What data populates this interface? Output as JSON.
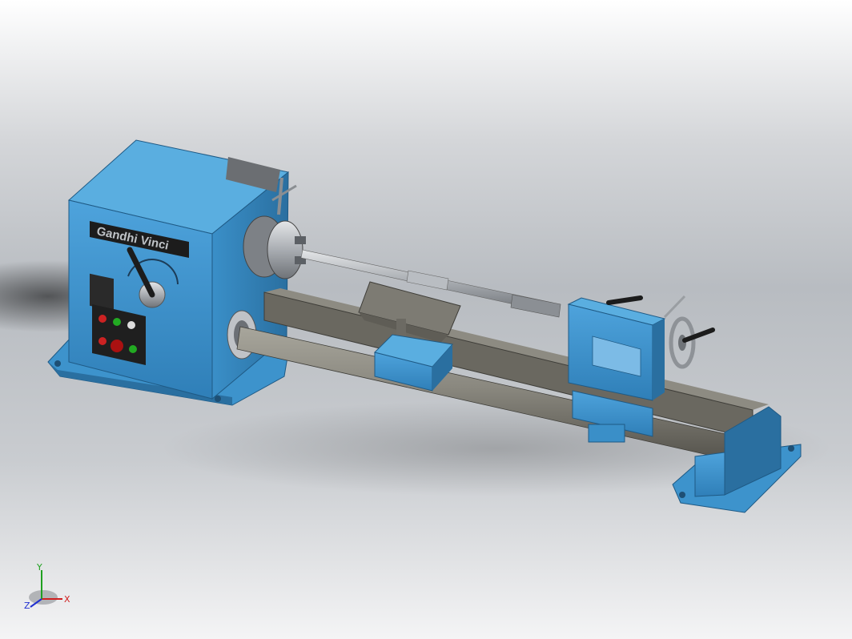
{
  "scene": {
    "description_free": true,
    "brand_plate_text": "Gandhi Vinci",
    "colors": {
      "background_top": "#ffffff",
      "background_mid": "#b8bcc1",
      "machine_blue": "#3a8fc8",
      "machine_blue_dark": "#2a6fa0",
      "machine_blue_light": "#5aaee0",
      "steel": "#8a8880",
      "steel_dark": "#5e5c55",
      "chrome": "#c8ccd0",
      "plate": "#1c1c1c"
    }
  },
  "triad": {
    "x_label": "X",
    "y_label": "Y",
    "z_label": "Z",
    "x_color": "#d02020",
    "y_color": "#20a020",
    "z_color": "#2030d0"
  }
}
